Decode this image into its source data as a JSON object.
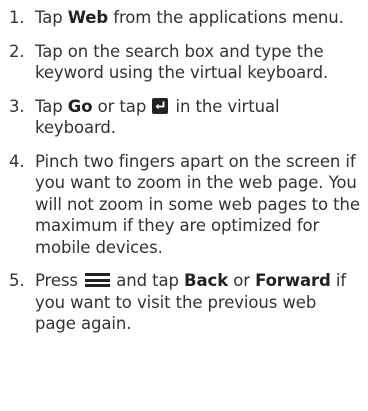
{
  "steps": [
    {
      "number": "1.",
      "t1": "Tap ",
      "b1": "Web",
      "t2": " from the applications menu."
    },
    {
      "number": "2.",
      "text": "Tap on the search box and type the keyword using the virtual keyboard."
    },
    {
      "number": "3.",
      "t1": "Tap ",
      "b1": "Go",
      "t2": " or tap ",
      "t3": " in the virtual keyboard."
    },
    {
      "number": "4.",
      "text": "Pinch two fingers apart on the screen if you want to zoom in the web page. You will not zoom in some web pages to the maximum if they are optimized for mobile devices."
    },
    {
      "number": "5.",
      "t1": "Press ",
      "t2": " and tap ",
      "b1": "Back",
      "t3": " or ",
      "b2": "Forward",
      "t4": " if you want to visit the previous web page again."
    }
  ],
  "icons": {
    "enter_key": "enter-key-icon",
    "menu_key": "menu-key-icon"
  }
}
